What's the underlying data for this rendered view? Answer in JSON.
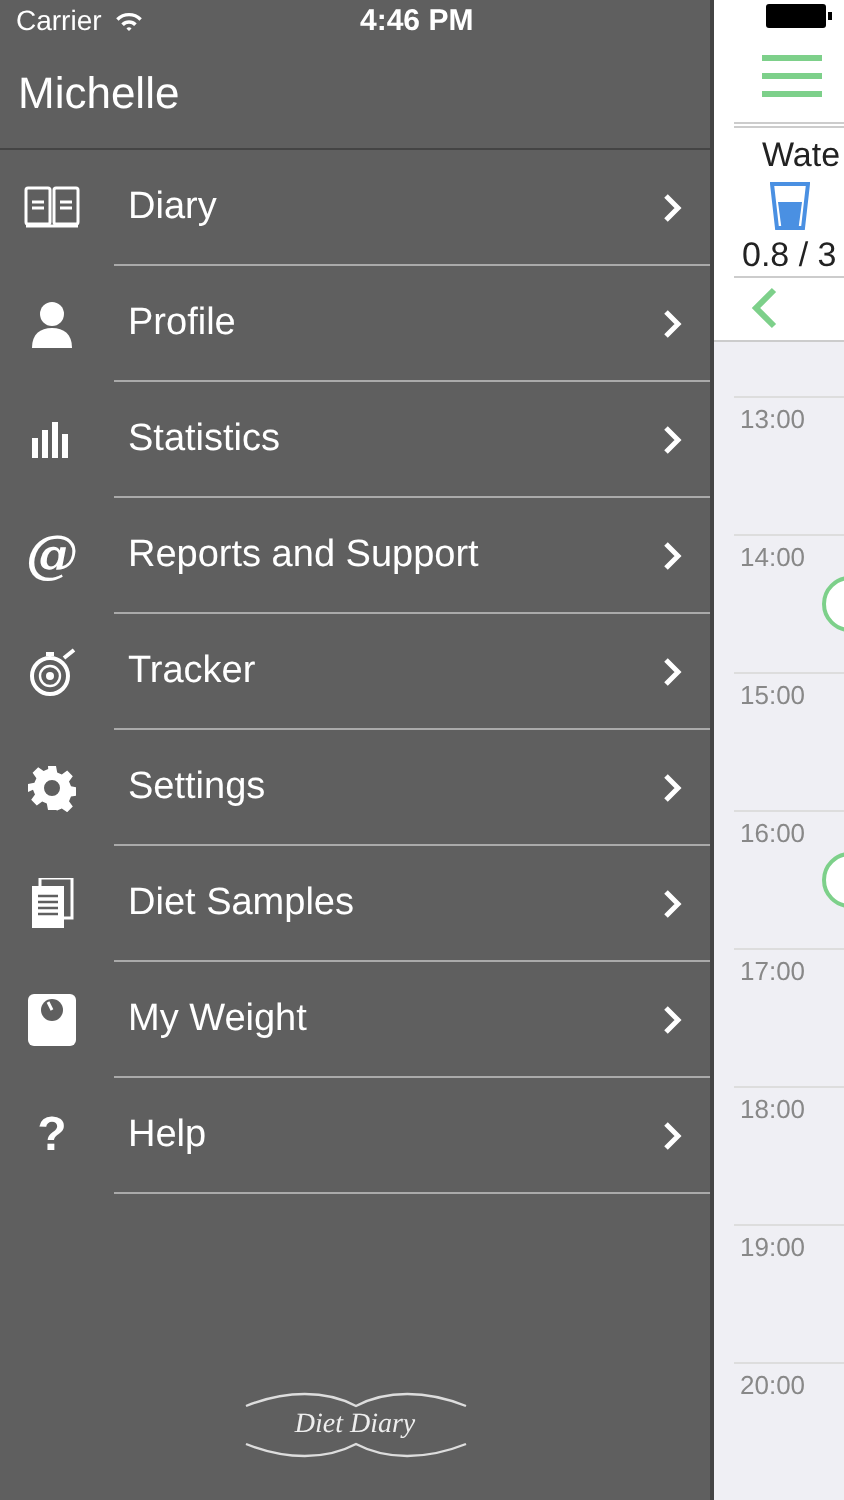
{
  "status_bar": {
    "carrier": "Carrier",
    "time": "4:46 PM"
  },
  "user": {
    "name": "Michelle"
  },
  "menu": [
    {
      "label": "Diary",
      "kind": "book"
    },
    {
      "label": "Profile",
      "kind": "person"
    },
    {
      "label": "Statistics",
      "kind": "bars"
    },
    {
      "label": "Reports and Support",
      "kind": "at",
      "glyph": "@"
    },
    {
      "label": "Tracker",
      "kind": "stopwatch"
    },
    {
      "label": "Settings",
      "kind": "gear"
    },
    {
      "label": "Diet Samples",
      "kind": "pages"
    },
    {
      "label": "My Weight",
      "kind": "scale"
    },
    {
      "label": "Help",
      "kind": "help",
      "glyph": "?"
    }
  ],
  "logo": "Diet Diary",
  "water": {
    "title": "Wate",
    "amount": "0.8 / 3"
  },
  "timeline": [
    {
      "time": "13:00",
      "entry": false
    },
    {
      "time": "14:00",
      "entry": true
    },
    {
      "time": "15:00",
      "entry": false
    },
    {
      "time": "16:00",
      "entry": true
    },
    {
      "time": "17:00",
      "entry": false
    },
    {
      "time": "18:00",
      "entry": false
    },
    {
      "time": "19:00",
      "entry": false
    },
    {
      "time": "20:00",
      "entry": false
    }
  ]
}
